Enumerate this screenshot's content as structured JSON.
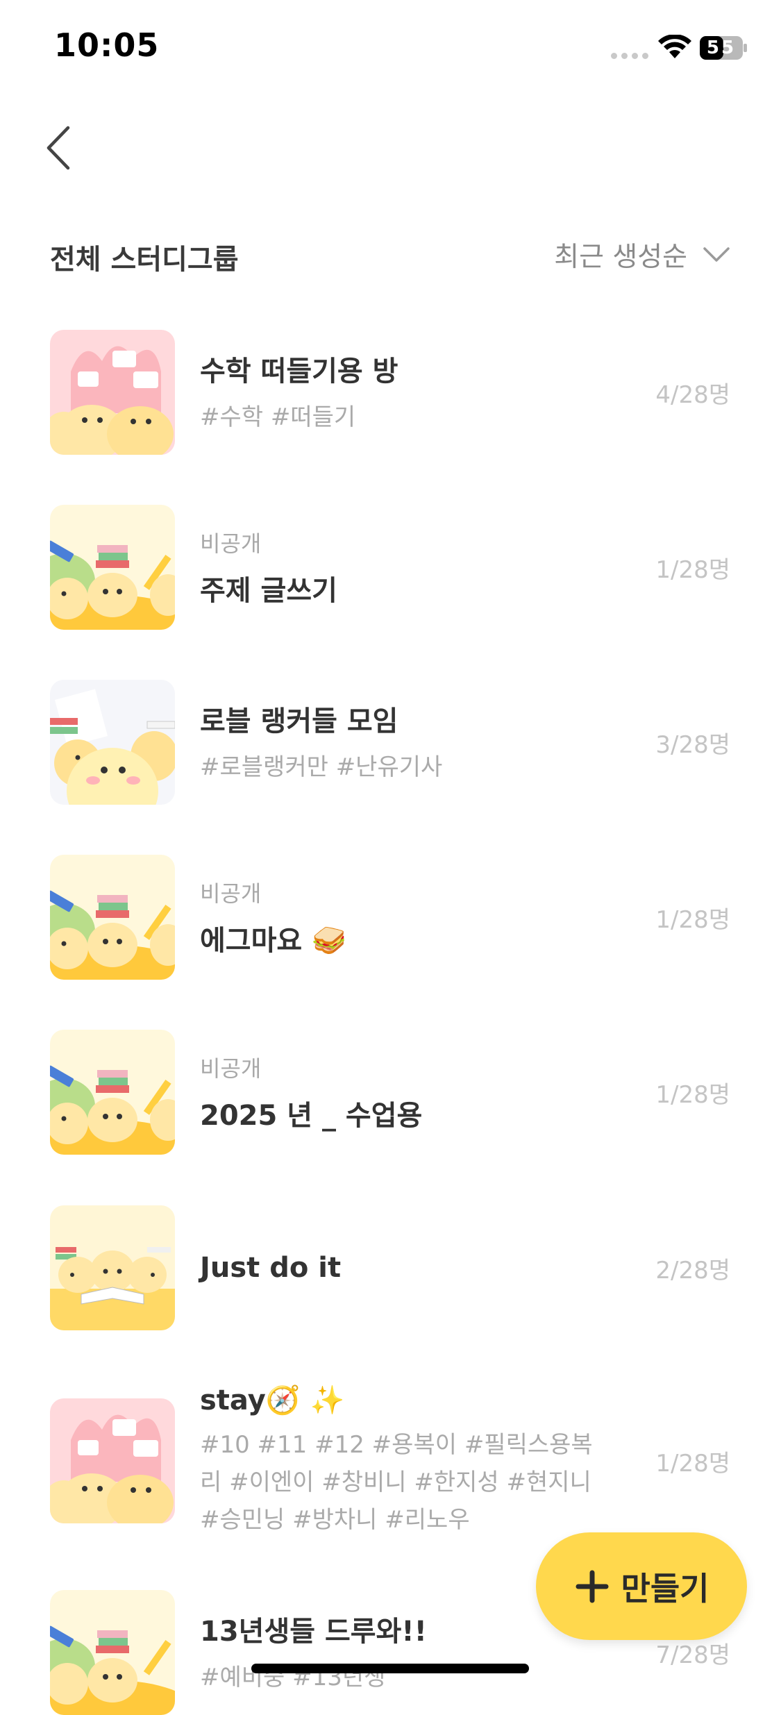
{
  "status": {
    "time": "10:05",
    "battery": "55"
  },
  "header": {
    "title": "전체 스터디그룹",
    "sort_label": "최근 생성순"
  },
  "groups": [
    {
      "private": "",
      "name": "수학 떠들기용 방",
      "tags": "#수학 #떠들기",
      "count": "4/28명",
      "thumb": "pink"
    },
    {
      "private": "비공개",
      "name": "주제 글쓰기",
      "tags": "",
      "count": "1/28명",
      "thumb": "books"
    },
    {
      "private": "",
      "name": "로블 랭커들 모임",
      "tags": "#로블랭커만 #난유기사",
      "count": "3/28명",
      "thumb": "white"
    },
    {
      "private": "비공개",
      "name": "에그마요 🥪",
      "tags": "",
      "count": "1/28명",
      "thumb": "books"
    },
    {
      "private": "비공개",
      "name": "2025 년 _ 수업용",
      "tags": "",
      "count": "1/28명",
      "thumb": "books"
    },
    {
      "private": "",
      "name": "Just do it",
      "tags": "",
      "count": "2/28명",
      "thumb": "read"
    },
    {
      "private": "",
      "name": "stay🧭 ✨",
      "tags": "#10 #11 #12 #용복이 #필릭스용복리 #이엔이 #창비니 #한지성 #현지니 #승민닝 #방차니 #리노우",
      "count": "1/28명",
      "thumb": "pink"
    },
    {
      "private": "",
      "name": "13년생들 드루와!!",
      "tags": "#예비중 #13년생",
      "count": "7/28명",
      "thumb": "books"
    }
  ],
  "fab": {
    "label": "만들기"
  },
  "colors": {
    "accent": "#ffd84d",
    "muted": "#aaaaaa"
  }
}
